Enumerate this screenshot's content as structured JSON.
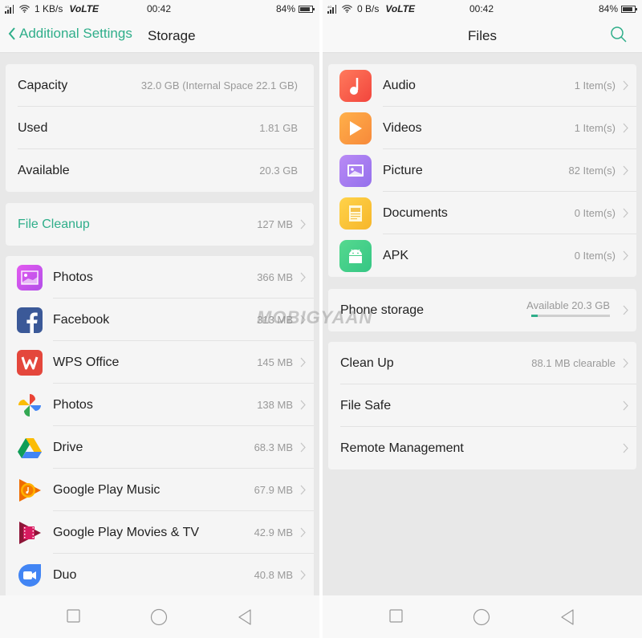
{
  "left": {
    "status": {
      "network": "4G",
      "speed": "1 KB/s",
      "volte": "VoLTE",
      "time": "00:42",
      "battery": "84%",
      "battery_level": 0.84
    },
    "header": {
      "back_label": "Additional Settings",
      "title": "Storage"
    },
    "summary": [
      {
        "label": "Capacity",
        "value": "32.0 GB (Internal Space 22.1 GB)"
      },
      {
        "label": "Used",
        "value": "1.81 GB"
      },
      {
        "label": "Available",
        "value": "20.3 GB"
      }
    ],
    "cleanup": {
      "label": "File Cleanup",
      "value": "127 MB"
    },
    "apps": [
      {
        "name": "Photos",
        "size": "366 MB",
        "icon": "gallery-icon"
      },
      {
        "name": "Facebook",
        "size": "313 MB",
        "icon": "facebook-icon"
      },
      {
        "name": "WPS Office",
        "size": "145 MB",
        "icon": "wps-office-icon"
      },
      {
        "name": "Photos",
        "size": "138 MB",
        "icon": "google-photos-icon"
      },
      {
        "name": "Drive",
        "size": "68.3 MB",
        "icon": "google-drive-icon"
      },
      {
        "name": "Google Play Music",
        "size": "67.9 MB",
        "icon": "play-music-icon"
      },
      {
        "name": "Google Play Movies & TV",
        "size": "42.9 MB",
        "icon": "play-movies-icon"
      },
      {
        "name": "Duo",
        "size": "40.8 MB",
        "icon": "duo-icon"
      }
    ]
  },
  "right": {
    "status": {
      "network": "4G",
      "speed": "0 B/s",
      "volte": "VoLTE",
      "time": "00:42",
      "battery": "84%",
      "battery_level": 0.84
    },
    "header": {
      "title": "Files"
    },
    "categories": [
      {
        "name": "Audio",
        "count": "1 Item(s)",
        "icon": "music-note-icon",
        "color": "#f75a4a"
      },
      {
        "name": "Videos",
        "count": "1 Item(s)",
        "icon": "play-icon",
        "color": "#f99a3c"
      },
      {
        "name": "Picture",
        "count": "82 Item(s)",
        "icon": "picture-icon",
        "color": "#a57af0"
      },
      {
        "name": "Documents",
        "count": "0 Item(s)",
        "icon": "document-icon",
        "color": "#f7c233"
      },
      {
        "name": "APK",
        "count": "0 Item(s)",
        "icon": "android-icon",
        "color": "#3fd08a"
      }
    ],
    "phone_storage": {
      "label": "Phone storage",
      "available": "Available 20.3 GB",
      "used_fraction": 0.08
    },
    "tools": [
      {
        "label": "Clean Up",
        "value": "88.1 MB clearable"
      },
      {
        "label": "File Safe",
        "value": ""
      },
      {
        "label": "Remote Management",
        "value": ""
      }
    ]
  },
  "watermark": "MOBIGYAAN",
  "colors": {
    "accent": "#2fae8a",
    "background": "#e8e8e8",
    "card": "#f5f5f5"
  }
}
